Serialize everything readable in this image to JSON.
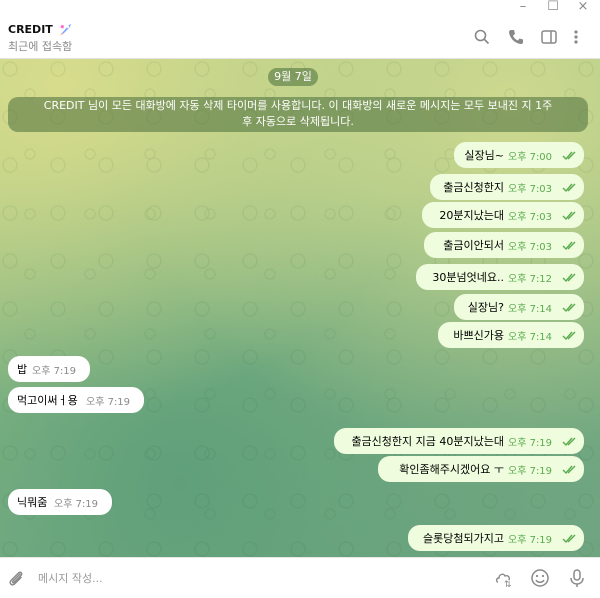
{
  "window": {
    "minimize": "–",
    "maximize": "☐",
    "close": "×"
  },
  "header": {
    "chat_name": "CREDIT",
    "status": "최근에 접속함",
    "icons": [
      "search-icon",
      "phone-icon",
      "sidebar-icon",
      "more-icon"
    ]
  },
  "chat": {
    "date_pill": "9월 7일",
    "system_message_line1": "CREDIT 님이 모든 대화방에 자동 삭제 타이머를 사용합니다. 이 대화방의 새로운 메시지는 모두 보내진 지 1주",
    "system_message_line2": "후 자동으로 삭제됩니다.",
    "messages": [
      {
        "dir": "out",
        "text": "실장님~",
        "time": "오후 7:00"
      },
      {
        "dir": "out",
        "text": "출금신청한지",
        "time": "오후 7:03"
      },
      {
        "dir": "out",
        "text": "20분지났는대",
        "time": "오후 7:03"
      },
      {
        "dir": "out",
        "text": "출금이안되서",
        "time": "오후 7:03"
      },
      {
        "dir": "out",
        "text": "30분넘엇네요..",
        "time": "오후 7:12"
      },
      {
        "dir": "out",
        "text": "실장님?",
        "time": "오후 7:14"
      },
      {
        "dir": "out",
        "text": "바쁘신가용",
        "time": "오후 7:14"
      },
      {
        "dir": "in",
        "text": "밥",
        "time": "오후 7:19"
      },
      {
        "dir": "in",
        "text": "먹고이써ㅓ용",
        "time": "오후 7:19"
      },
      {
        "dir": "out",
        "text": "출금신청한지 지금 40분지났는대",
        "time": "오후 7:19"
      },
      {
        "dir": "out",
        "text": "확인좀해주시겠어요 ㅜ",
        "time": "오후 7:19"
      },
      {
        "dir": "in",
        "text": "닉뭐줌",
        "time": "오후 7:19"
      },
      {
        "dir": "out",
        "text": "슬롯당첨되가지고",
        "time": "오후 7:19"
      }
    ]
  },
  "composer": {
    "placeholder": "메시지 작성...",
    "icons": [
      "attach-icon",
      "bot-commands-icon",
      "emoji-icon",
      "microphone-icon"
    ]
  },
  "colors": {
    "out_bubble": "#effdde",
    "in_bubble": "#ffffff",
    "check": "#5aab4e"
  }
}
